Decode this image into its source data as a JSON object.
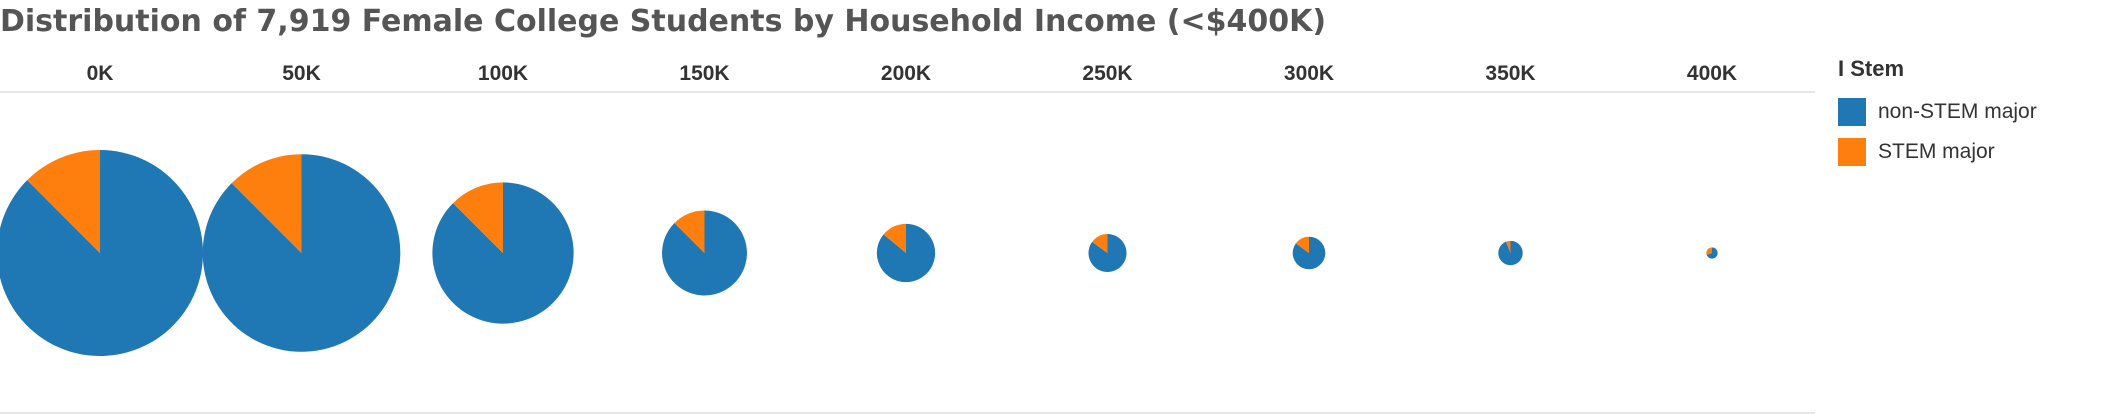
{
  "title": "Distribution of 7,919 Female College Students by Household Income (<$400K)",
  "legend": {
    "title": "I Stem",
    "items": [
      {
        "label": "non-STEM major",
        "color": "#1f77b4"
      },
      {
        "label": "STEM major",
        "color": "#ff7f0e"
      }
    ]
  },
  "chart_data": {
    "type": "pie",
    "title": "Distribution of 7,919 Female College Students by Household Income (<$400K)",
    "categories": [
      "0K",
      "50K",
      "100K",
      "150K",
      "200K",
      "250K",
      "300K",
      "350K",
      "400K"
    ],
    "series": [
      {
        "name": "non-STEM major",
        "color": "#1f77b4"
      },
      {
        "name": "STEM major",
        "color": "#ff7f0e"
      }
    ],
    "pies": [
      {
        "category": "0K",
        "size": 1.0,
        "stem_share": 0.125
      },
      {
        "category": "50K",
        "size": 0.92,
        "stem_share": 0.125
      },
      {
        "category": "100K",
        "size": 0.47,
        "stem_share": 0.125
      },
      {
        "category": "150K",
        "size": 0.17,
        "stem_share": 0.125
      },
      {
        "category": "200K",
        "size": 0.08,
        "stem_share": 0.14
      },
      {
        "category": "250K",
        "size": 0.034,
        "stem_share": 0.15
      },
      {
        "category": "300K",
        "size": 0.025,
        "stem_share": 0.15
      },
      {
        "category": "350K",
        "size": 0.014,
        "stem_share": 0.06
      },
      {
        "category": "400K",
        "size": 0.003,
        "stem_share": 0.3
      }
    ]
  }
}
